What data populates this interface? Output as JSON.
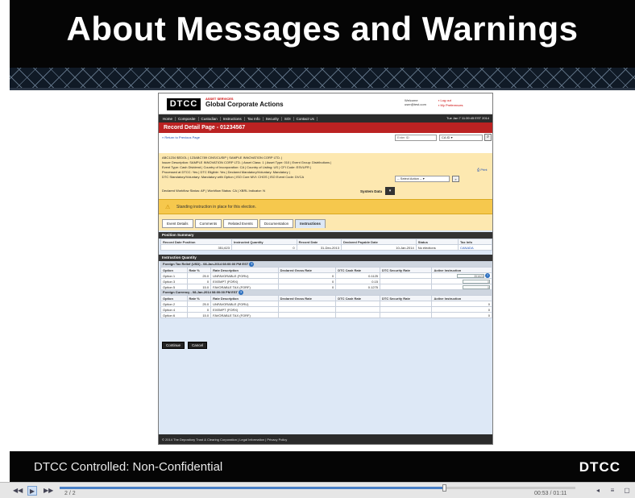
{
  "slide": {
    "title": "About Messages and Warnings",
    "footer_text": "DTCC Controlled: Non-Confidential",
    "footer_logo": "DTCC"
  },
  "app": {
    "logo": "DTCC",
    "subtitle": "ASSET SERVICES",
    "name": "Global Corporate Actions",
    "welcome_label": "Welcome",
    "user": "user@test.com",
    "user_links": [
      "Log out",
      "My Preferences"
    ],
    "nav": [
      "Home",
      "Composite",
      "Custodian",
      "Instructions",
      "Tax Info",
      "Security",
      "SOI",
      "Contact Us"
    ],
    "nav_date": "Tue Jan 7 11:39:45 EST 2014",
    "page_title": "Record Detail Page - 01234567",
    "crumb": "« Return to Previous Page",
    "id_placeholder": "Enter ID",
    "id_type": "CA ID",
    "info_lines": [
      "ABC1234 $EDOL | 123ABC789 CINS/CUSIP | SAMPLE INNOVATION CORP LTD. |",
      "Issuer Description: SAMPLE INNOVATION CORP LTD. | Asset Class: 1 | Asset Type: 010 | Event Group: Distributions |",
      "Event Type: Cash Dividend | Country of Incorporation: CA | Country of Listing: US | CFI Code: ESVUFR |",
      "Processed at DTCC: Yes | DTC Eligible: Yes | Declared Mandatory/Voluntary: Mandatory |",
      "DTC Standatory/Voluntary: Mandatory with Option | ISO Core MVI: CHOS | ISO Event Code: DVCA"
    ],
    "workflow_line": "Declared Workflow Status: AP | Workflow Status: CA | XBRL Indicator: N",
    "select_action": "-- Select Action --",
    "go_label": "»",
    "print_label": "Print",
    "system_data_label": "System Data",
    "warning": "Standing instruction in place for this election.",
    "tabs": [
      "Event Details",
      "Comments",
      "Related Events",
      "Documentation",
      "Instructions"
    ],
    "position_summary": {
      "title": "Position Summary",
      "headers": [
        "Record Date Position",
        "Instructed Quantity",
        "Record Date",
        "Declared Payable Date",
        "Status",
        "Tax Info"
      ],
      "row": [
        "351,623",
        "0",
        "31-Dec-2013",
        "10-Jan-2014",
        "No elections",
        "CANADA"
      ]
    },
    "instruction_quantity_title": "Instruction Quantity",
    "usd_section": "Foreign Tax Relief (USD) - 08-Jan-2014 08:00:00 PM EST",
    "inst_headers": [
      "Option",
      "Rate %",
      "Rate Description",
      "Declared Gross Rate",
      "DTC Cash Rate",
      "DTC Security Rate",
      "Active Instruction"
    ],
    "usd_rows": [
      [
        "Option 1",
        "25.0",
        "UNFAVORABLE (FORU)",
        "0",
        "0.1125",
        "",
        "351623"
      ],
      [
        "Option 3",
        "0",
        "EXEMPT (FORX)",
        "0",
        "0.15",
        "",
        "0"
      ],
      [
        "Option 5",
        "15.0",
        "FAVORABLE TAX (FORF)",
        "0",
        "0.1275",
        "",
        "0"
      ]
    ],
    "fc_section": "Foreign Currency - 08-Jan-2014 08:00:00 PM EST",
    "fc_rows": [
      [
        "Option 2",
        "25.0",
        "UNFAVORABLE (FORU)",
        "",
        "",
        "",
        "0"
      ],
      [
        "Option 4",
        "0",
        "EXEMPT (FORX)",
        "",
        "",
        "",
        "0"
      ],
      [
        "Option 6",
        "15.0",
        "FAVORABLE TAX (FORF)",
        "",
        "",
        "",
        "0"
      ]
    ],
    "continue_label": "Continue",
    "cancel_label": "Cancel",
    "footer": "© 2014 The Depository Trust & Clearing Corporation | Legal Information | Privacy Policy"
  },
  "player": {
    "slide_count": "2 / 2",
    "time": "00:53 / 01:11",
    "progress": 0.746
  }
}
